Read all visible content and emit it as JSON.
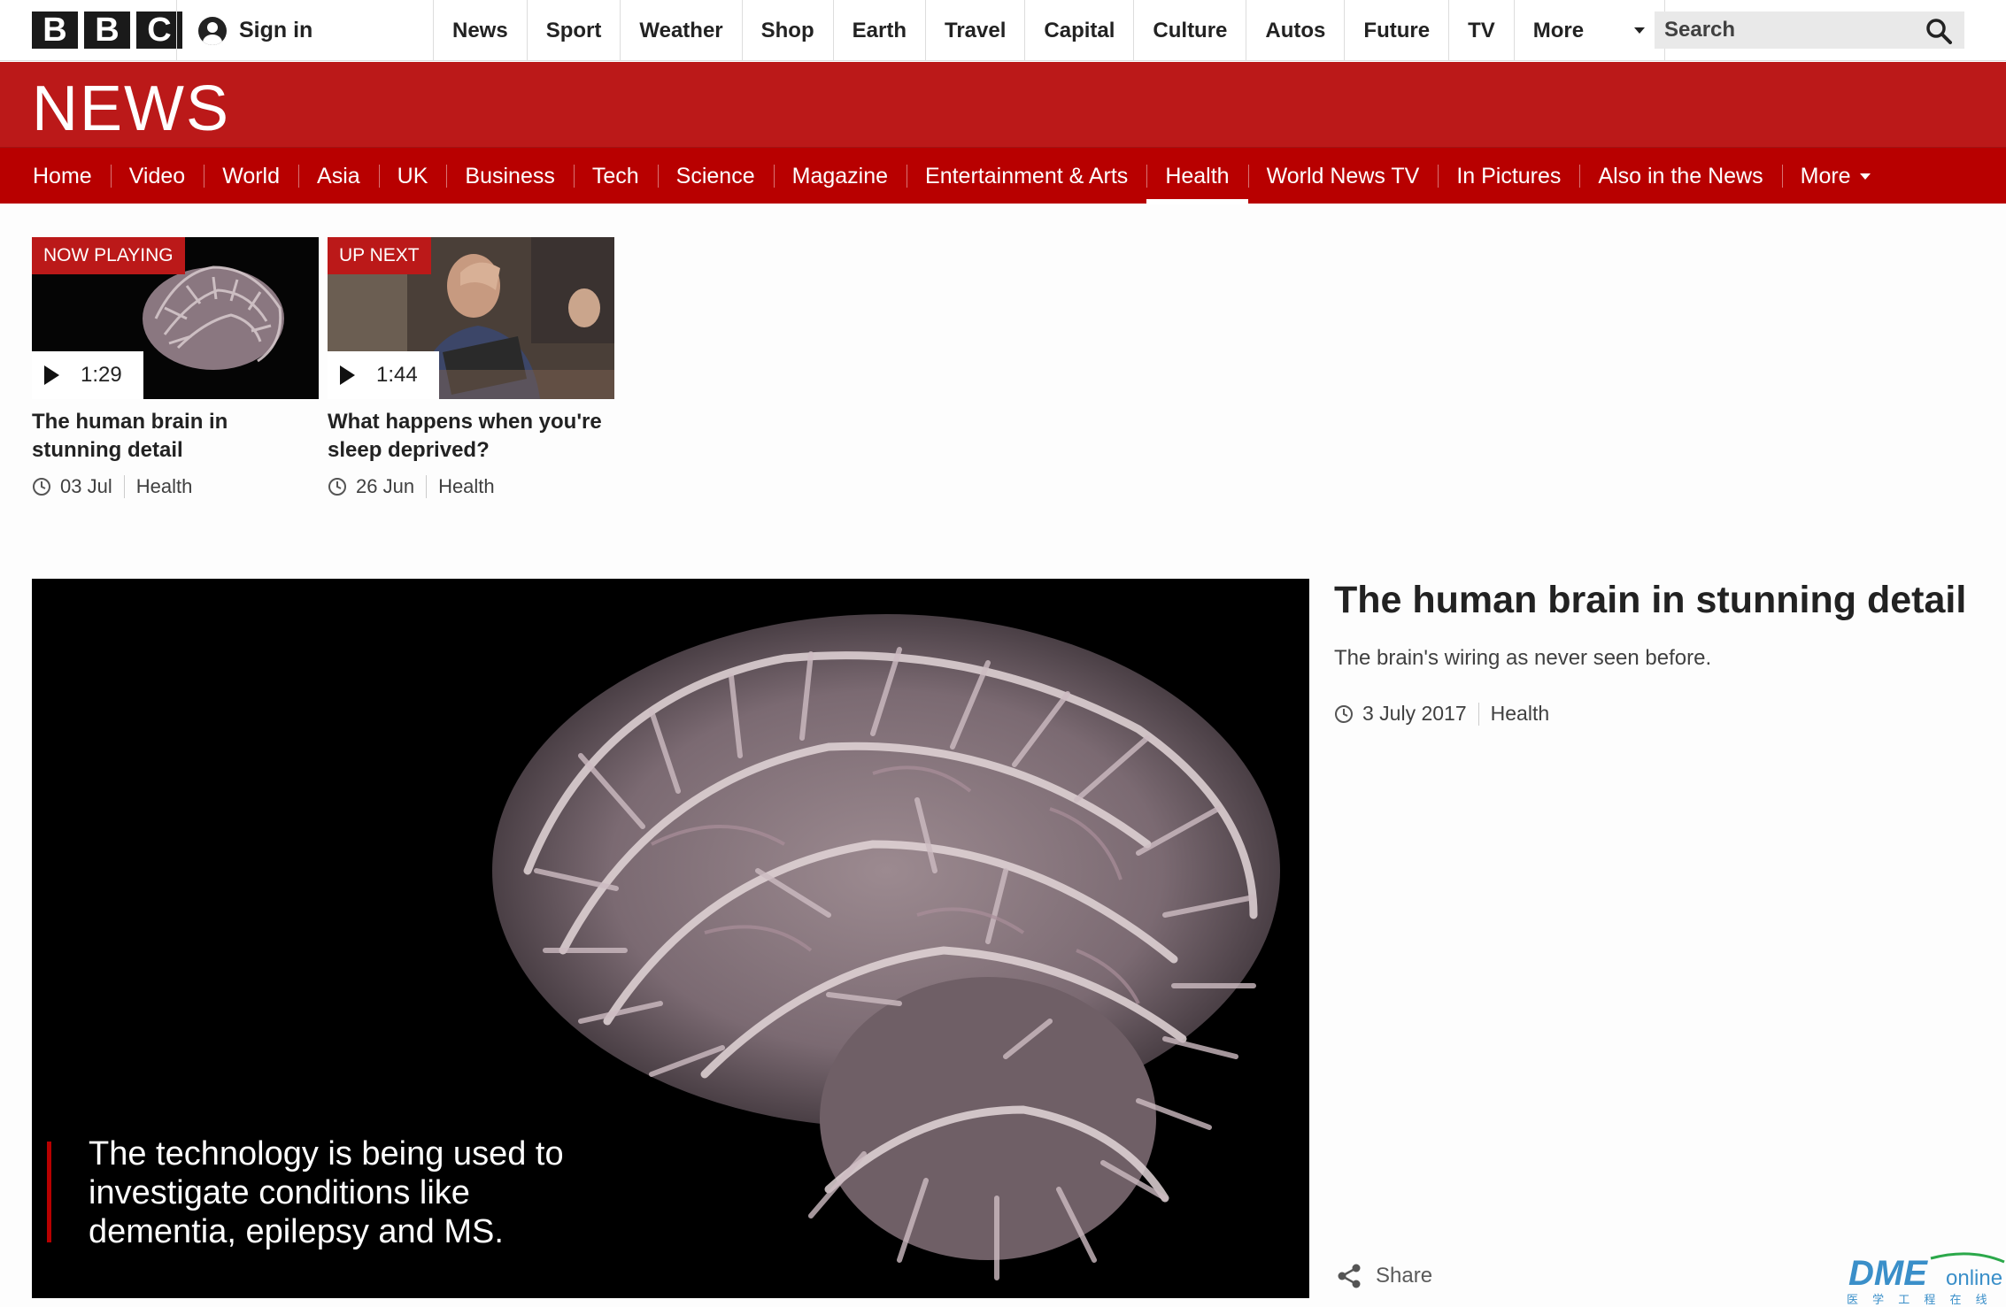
{
  "topbar": {
    "logo_letters": [
      "B",
      "B",
      "C"
    ],
    "sign_in": "Sign in",
    "nav": [
      "News",
      "Sport",
      "Weather",
      "Shop",
      "Earth",
      "Travel",
      "Capital",
      "Culture",
      "Autos",
      "Future",
      "TV"
    ],
    "more": "More",
    "search_label": "Search"
  },
  "banner": {
    "title": "NEWS",
    "color": "#bb1919"
  },
  "section_nav": {
    "items": [
      "Home",
      "Video",
      "World",
      "Asia",
      "UK",
      "Business",
      "Tech",
      "Science",
      "Magazine",
      "Entertainment & Arts",
      "Health",
      "World News TV",
      "In Pictures",
      "Also in the News"
    ],
    "active": "Health",
    "more": "More",
    "color": "#b80000"
  },
  "playlist": [
    {
      "badge": "NOW PLAYING",
      "duration": "1:29",
      "title": "The human brain in stunning detail",
      "date": "03 Jul",
      "section": "Health"
    },
    {
      "badge": "UP NEXT",
      "duration": "1:44",
      "title": "What happens when you're sleep deprived?",
      "date": "26 Jun",
      "section": "Health"
    }
  ],
  "video": {
    "caption": "The technology is being used to investigate conditions like dementia, epilepsy and MS."
  },
  "story": {
    "title": "The human brain in stunning detail",
    "summary": "The brain's wiring as never seen before.",
    "date": "3 July 2017",
    "section": "Health",
    "share": "Share"
  },
  "watermark": {
    "brand": "DME",
    "suffix": "online",
    "tagline": "医 学 工 程 在 线"
  }
}
